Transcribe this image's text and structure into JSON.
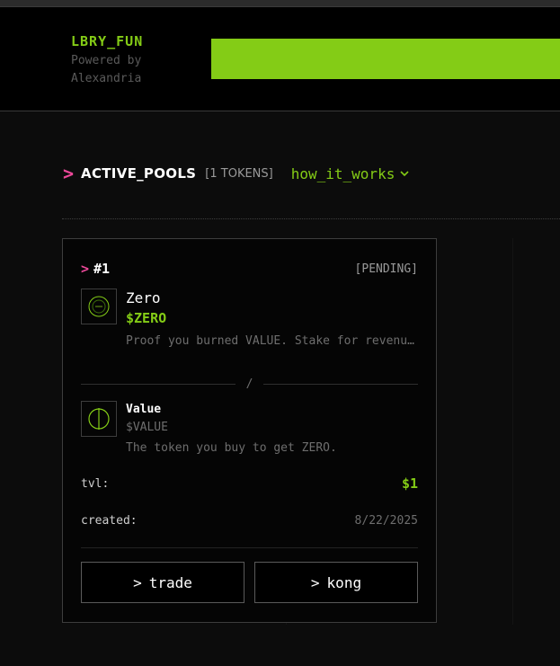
{
  "brand": {
    "title": "LBRY_FUN",
    "subtitle": "Powered by Alexandria"
  },
  "section": {
    "title": "ACTIVE_POOLS",
    "count": "[1 TOKENS]",
    "how_it_works": "how_it_works"
  },
  "card": {
    "index": "#1",
    "status": "[PENDING]",
    "primary": {
      "name": "Zero",
      "symbol": "$ZERO",
      "description": "Proof you burned VALUE. Stake for revenue share."
    },
    "divider": "/",
    "secondary": {
      "name": "Value",
      "symbol": "$VALUE",
      "description": "The token you buy to get ZERO."
    },
    "tvl_label": "tvl:",
    "tvl_value": "$1",
    "created_label": "created:",
    "created_value": "8/22/2025",
    "buttons": {
      "trade": "trade",
      "kong": "kong",
      "prefix": ">"
    }
  },
  "icons": {
    "chevron": "chevron-right-icon",
    "dropdown": "chevron-down-icon"
  },
  "colors": {
    "accent": "#84cc16",
    "pink": "#ec4899",
    "background": "#0b0b0b"
  }
}
